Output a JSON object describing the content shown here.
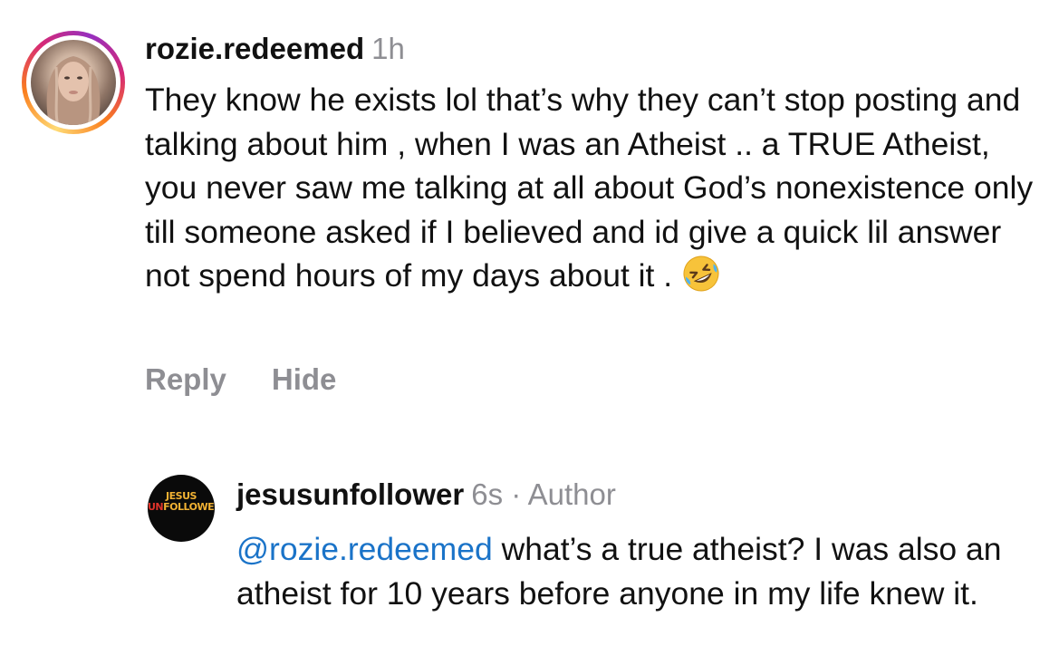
{
  "comments": [
    {
      "username": "rozie.redeemed",
      "time": "1h",
      "text": "They know he exists lol that’s why they can’t stop posting and talking about him , when I was an Atheist .. a TRUE Atheist, you never saw me talking at all about God’s nonexistence only till someone asked if I believed and id give a quick lil answer not spend hours of my days about it .",
      "emoji": "rolling-on-the-floor-laughing",
      "reply_label": "Reply",
      "hide_label": "Hide"
    },
    {
      "username": "jesusunfollower",
      "time": "6s",
      "author_tag": "· Author",
      "mention": "@rozie.redeemed",
      "text": " what’s a true atheist? I was also an atheist for 10 years before anyone in my life knew it.",
      "avatar_logo_line1": "JESUS",
      "avatar_logo_line2_red": "UN",
      "avatar_logo_line2_rest": "FOLLOWER"
    }
  ],
  "colors": {
    "username": "#111111",
    "muted": "#8e8e93",
    "mention": "#1a73c8",
    "logo_gold": "#f2b233",
    "logo_red": "#e0342b"
  }
}
